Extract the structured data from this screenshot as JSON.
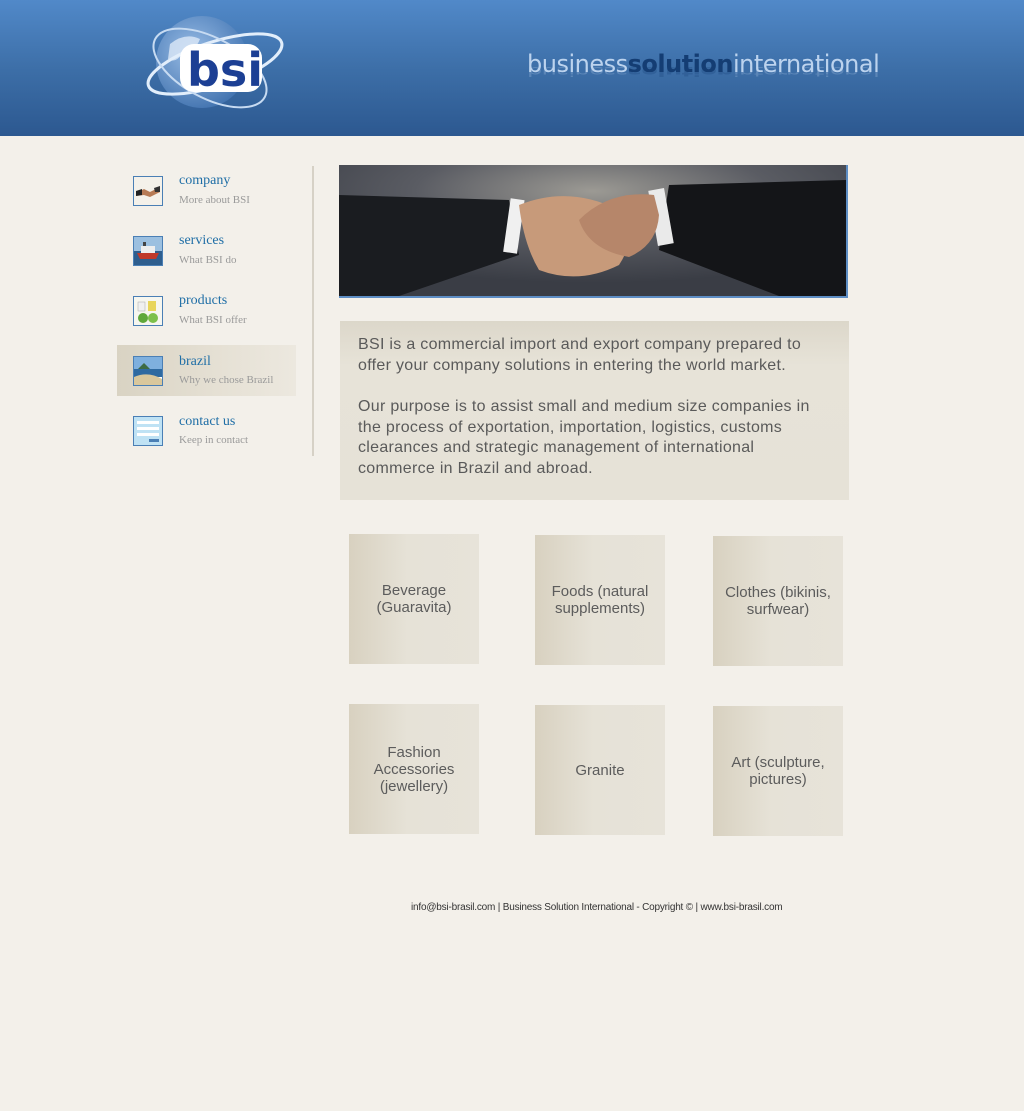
{
  "header": {
    "logo_text": "bsi",
    "tagline": {
      "part1": "business",
      "part2": "solution",
      "part3": "international"
    }
  },
  "sidebar": {
    "items": [
      {
        "title": "company",
        "subtitle": "More about BSI",
        "icon": "handshake-icon"
      },
      {
        "title": "services",
        "subtitle": "What BSI do",
        "icon": "ship-icon"
      },
      {
        "title": "products",
        "subtitle": "What BSI offer",
        "icon": "products-icon"
      },
      {
        "title": "brazil",
        "subtitle": "Why we chose Brazil",
        "icon": "beach-icon",
        "active": true
      },
      {
        "title": "contact us",
        "subtitle": "Keep in contact",
        "icon": "form-icon"
      }
    ]
  },
  "intro": {
    "paragraph1": "BSI is a commercial import and export company prepared to offer your company solutions in entering the world market.",
    "paragraph2": "Our purpose is to assist small and medium size companies in the process of exportation, importation, logistics, customs clearances and strategic management of international commerce in Brazil and abroad."
  },
  "products": [
    "Beverage (Guaravita)",
    "Foods (natural supplements)",
    "Clothes (bikinis, surfwear)",
    "Fashion Accessories (jewellery)",
    "Granite",
    "Art (sculpture, pictures)"
  ],
  "footer": {
    "email": "info@bsi-brasil.com",
    "copyright": "Business Solution International - Copyright ©",
    "website": "www.bsi-brasil.com"
  },
  "colors": {
    "header_blue": "#3d6fa8",
    "nav_link": "#1f6ea6",
    "page_bg": "#f3f0ea"
  }
}
